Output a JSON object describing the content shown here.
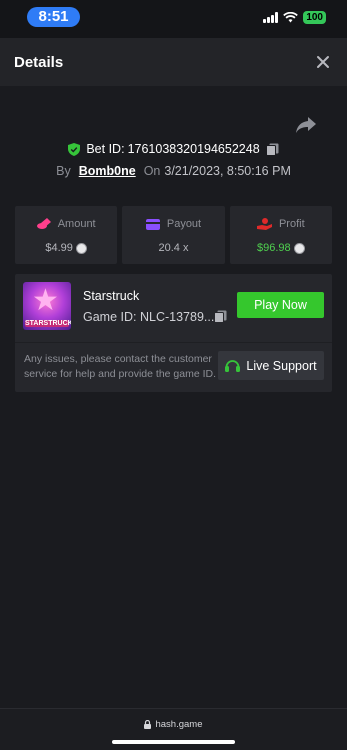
{
  "status_bar": {
    "time": "8:51",
    "battery": "100"
  },
  "header": {
    "title": "Details",
    "close_icon": "close-icon"
  },
  "bet": {
    "id_label": "Bet ID:",
    "id_value": "1761038320194652248",
    "by_label": "By",
    "user": "Bomb0ne",
    "on_label": "On",
    "datetime": "3/21/2023, 8:50:16 PM"
  },
  "stats": {
    "amount": {
      "label": "Amount",
      "value": "$4.99",
      "icon": "coins-icon",
      "color": "#ff3f8c"
    },
    "payout": {
      "label": "Payout",
      "value": "20.4 x",
      "icon": "card-icon",
      "color": "#8a4fff"
    },
    "profit": {
      "label": "Profit",
      "value": "$96.98",
      "icon": "hand-coin-icon",
      "color": "#e02a2a",
      "value_color": "#4fd04f"
    }
  },
  "game": {
    "name": "Starstruck",
    "id_label": "Game ID:",
    "id_value": "NLC-13789...",
    "thumb_label": "STARSTRUCK",
    "play_label": "Play Now",
    "help_text": "Any issues, please contact the customer service for help and provide the game ID.",
    "support_label": "Live Support"
  },
  "footer": {
    "url": "hash.game"
  }
}
